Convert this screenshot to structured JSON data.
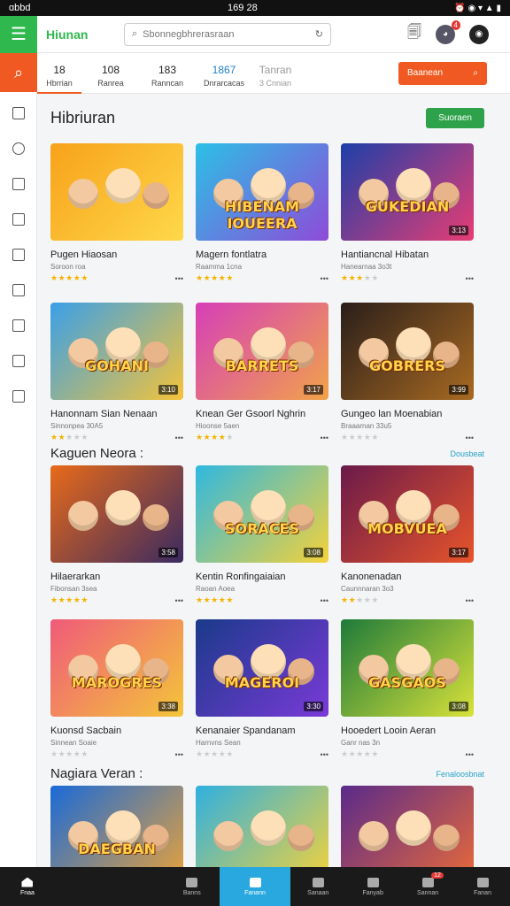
{
  "status": {
    "carrier": "ɑbbd",
    "time": "1⁠69 ⁠2⁠8",
    "icons": "⏰ ◉ ▾ ▲ ▮"
  },
  "topbar": {
    "brand": "Hiunan",
    "search_placeholder": "Sbonnegbhrerasraan",
    "badge": "4"
  },
  "tabs": [
    {
      "num": "18",
      "label": "Hbrrian"
    },
    {
      "num": "108",
      "label": "Ranrea"
    },
    {
      "num": "183",
      "label": "Ranncan"
    },
    {
      "num": "1867",
      "label": "Dnrarcacas"
    },
    {
      "num": "Tanran",
      "label": "3 Cnnian"
    }
  ],
  "tab_cta": "Baanean",
  "sections": [
    {
      "title": "Hibriuran",
      "action": "Suoraen"
    },
    {
      "title": "Kaguen Neora :",
      "action": "Dousbeat"
    },
    {
      "title": "Nagiara Veran :",
      "action": "Fenaloosbnat"
    }
  ],
  "cards": [
    {
      "title": "Pugen Hiaosan",
      "sub": "Soroon roa",
      "stars": 5,
      "dur": "",
      "logo": "",
      "colors": [
        "#f7a21a",
        "#ffd84a"
      ]
    },
    {
      "title": "Magern fontlatra",
      "sub": "Raamma 1cna",
      "stars": 5,
      "dur": "",
      "logo": "HIBENAM IOUEERA",
      "colors": [
        "#2cc0e6",
        "#8e4bd8"
      ]
    },
    {
      "title": "Hantiancnal Hibatan",
      "sub": "Hanearnaa 3o3t",
      "stars": 3,
      "dur": "3:13",
      "logo": "GUKEDIAN",
      "colors": [
        "#1d3fa8",
        "#e83d74"
      ]
    },
    {
      "title": "Hanonnam Sian Nenaan",
      "sub": "Sinnonpea 30A5",
      "stars": 2,
      "dur": "3:10",
      "logo": "GOHANI",
      "colors": [
        "#3aa0e8",
        "#f4c33a"
      ]
    },
    {
      "title": "Knean Ger Gsoorl Nghrin",
      "sub": "Hioonse 5aen",
      "stars": 4,
      "dur": "3:17",
      "logo": "BARRETS",
      "colors": [
        "#d63fb8",
        "#f1a34a"
      ]
    },
    {
      "title": "Gungeo lan Moenabian",
      "sub": "Braaarnan 33u5",
      "stars": 0,
      "dur": "3:99",
      "logo": "GOBRERS",
      "colors": [
        "#2a1e1a",
        "#a86a22"
      ]
    },
    {
      "title": "Hilaerarkan",
      "sub": "Fibonsan 3sea",
      "stars": 5,
      "dur": "3:58",
      "logo": "",
      "colors": [
        "#e86a1a",
        "#3a2a60"
      ]
    },
    {
      "title": "Kentin Ronfingaiaian",
      "sub": "Raoan Aoea",
      "stars": 5,
      "dur": "3:08",
      "logo": "SORACES",
      "colors": [
        "#2fb8e0",
        "#f4d23a"
      ]
    },
    {
      "title": "Kanonenadan",
      "sub": "Caunnnaran 3o3",
      "stars": 2,
      "dur": "3:17",
      "logo": "MOBVUEA",
      "colors": [
        "#6a1a4a",
        "#e8542a"
      ]
    },
    {
      "title": "Kuonsd Sacbain",
      "sub": "Sinnean Soaie",
      "stars": 0,
      "dur": "3:38",
      "logo": "MAROGRES",
      "colors": [
        "#f05a7a",
        "#f4c53a"
      ]
    },
    {
      "title": "Kenanaier Spandanam",
      "sub": "Harnvns Sean",
      "stars": 0,
      "dur": "3:30",
      "logo": "MAGEROI",
      "colors": [
        "#1a3a8a",
        "#7a3ad8"
      ]
    },
    {
      "title": "Hooedert Looin Aeran",
      "sub": "Ganr nas 3n",
      "stars": 0,
      "dur": "3:08",
      "logo": "GASGAOS",
      "colors": [
        "#1e7a3a",
        "#d8e23a"
      ]
    },
    {
      "title": "",
      "sub": "",
      "stars": 0,
      "dur": "",
      "logo": "DAEGBAN",
      "colors": [
        "#1a6ad8",
        "#e8a23a"
      ]
    },
    {
      "title": "",
      "sub": "",
      "stars": 0,
      "dur": "",
      "logo": "",
      "colors": [
        "#2fb0e0",
        "#f4d23a"
      ]
    },
    {
      "title": "",
      "sub": "",
      "stars": 0,
      "dur": "",
      "logo": "",
      "colors": [
        "#5a2a8a",
        "#e86a3a"
      ]
    }
  ],
  "bottomnav": [
    {
      "label": "Fnaa",
      "badge": ""
    },
    {
      "label": "",
      "badge": ""
    },
    {
      "label": "Banns",
      "badge": ""
    },
    {
      "label": "Fanann",
      "badge": ""
    },
    {
      "label": "Sanaan",
      "badge": ""
    },
    {
      "label": "Fanyab",
      "badge": ""
    },
    {
      "label": "Sannan",
      "badge": "12"
    },
    {
      "label": "Fanan",
      "badge": ""
    }
  ]
}
